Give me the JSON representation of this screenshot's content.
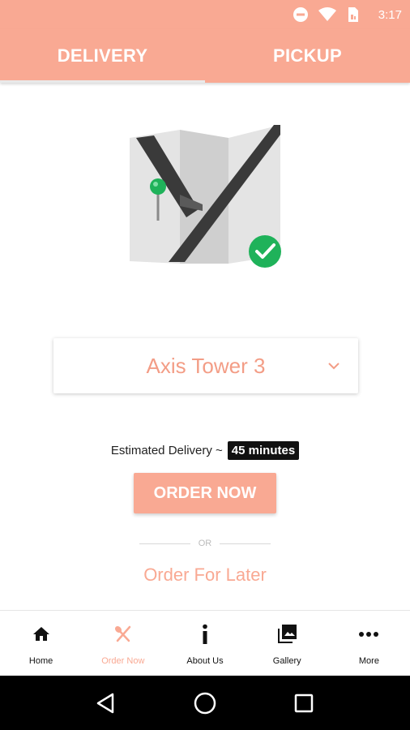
{
  "status_bar": {
    "time": "3:17",
    "icons": [
      "do-not-disturb-icon",
      "wifi-icon",
      "sim-icon",
      "battery-icon"
    ]
  },
  "tabs": [
    {
      "label": "DELIVERY",
      "active": true
    },
    {
      "label": "PICKUP",
      "active": false
    }
  ],
  "illustration": {
    "icon": "map-pin-check-illustration"
  },
  "location_select": {
    "value": "Axis Tower 3",
    "icon": "chevron-down-icon"
  },
  "estimate": {
    "label": "Estimated Delivery ~",
    "value": "45 minutes"
  },
  "order_now_label": "ORDER NOW",
  "divider_label": "OR",
  "order_later_label": "Order For Later",
  "bottom_nav": [
    {
      "label": "Home",
      "icon": "home-icon",
      "active": false
    },
    {
      "label": "Order Now",
      "icon": "fork-knife-icon",
      "active": true
    },
    {
      "label": "About Us",
      "icon": "info-icon",
      "active": false
    },
    {
      "label": "Gallery",
      "icon": "gallery-icon",
      "active": false
    },
    {
      "label": "More",
      "icon": "more-icon",
      "active": false
    }
  ],
  "colors": {
    "brand": "#f9a993",
    "success": "#1fb25a",
    "text_dark": "#111111"
  }
}
